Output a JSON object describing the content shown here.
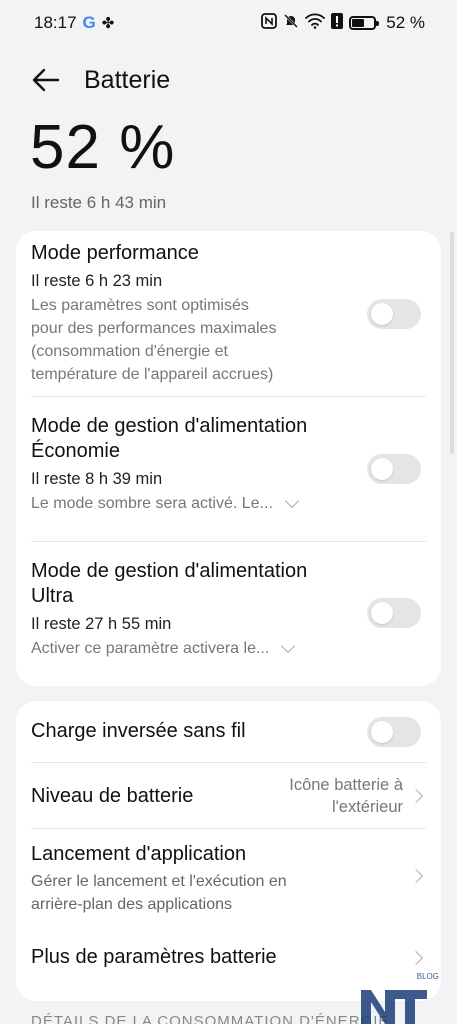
{
  "status_bar": {
    "time": "18:17",
    "battery_percent": "52 %",
    "battery_level": 0.52
  },
  "header": {
    "title": "Batterie"
  },
  "battery": {
    "percent": "52 %",
    "remaining": "Il reste 6 h 43 min"
  },
  "modes": [
    {
      "title": "Mode performance",
      "remaining": "Il reste 6 h 23 min",
      "description_lines": [
        "Les paramètres sont optimisés",
        "pour des performances maximales",
        "(consommation d'énergie et",
        "température de l'appareil accrues)"
      ],
      "enabled": false
    },
    {
      "title_lines": [
        "Mode de gestion d'alimentation",
        "Économie"
      ],
      "remaining": "Il reste 8 h 39 min",
      "description": "Le mode sombre sera activé. Le...",
      "enabled": false
    },
    {
      "title_lines": [
        "Mode de gestion d'alimentation",
        "Ultra"
      ],
      "remaining": "Il reste 27 h 55 min",
      "description": "Activer ce paramètre activera le...",
      "enabled": false
    }
  ],
  "settings": {
    "reverse_charge": {
      "label": "Charge inversée sans fil",
      "enabled": false
    },
    "battery_level": {
      "label": "Niveau de batterie",
      "value_lines": [
        "Icône batterie à",
        "l'extérieur"
      ]
    },
    "app_launch": {
      "label": "Lancement d'application",
      "description_lines": [
        "Gérer le lancement et l'exécution en",
        "arrière-plan des applications"
      ]
    },
    "more": {
      "label": "Plus de paramètres batterie"
    }
  },
  "footer": {
    "section_header": "DÉTAILS DE LA CONSOMMATION D'ÉNERGIE"
  },
  "watermark": {
    "logo_text": "NT",
    "tag": "BLOG"
  }
}
